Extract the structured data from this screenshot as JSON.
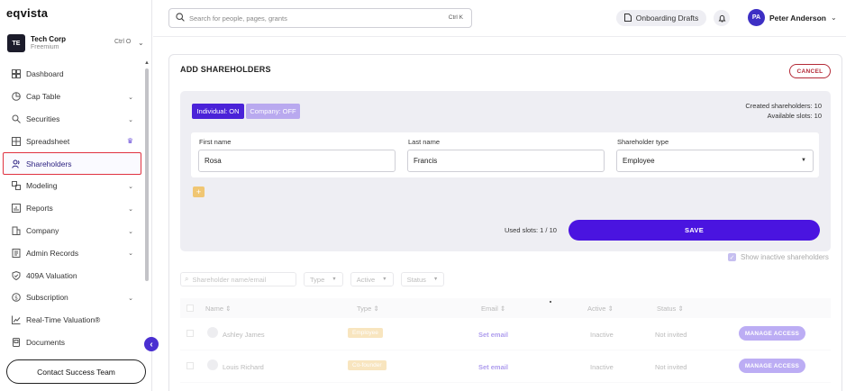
{
  "brand": {
    "logo": "eqvista"
  },
  "org": {
    "initials": "TE",
    "name": "Tech Corp",
    "plan": "Freemium",
    "shortcut": "Ctrl O"
  },
  "sidebar": {
    "items": [
      {
        "label": "Dashboard",
        "icon": "dashboard-icon",
        "chevron": false
      },
      {
        "label": "Cap Table",
        "icon": "pie-chart-icon",
        "chevron": true
      },
      {
        "label": "Securities",
        "icon": "securities-icon",
        "chevron": true
      },
      {
        "label": "Spreadsheet",
        "icon": "grid-icon",
        "chevron": false,
        "crown": true
      },
      {
        "label": "Shareholders",
        "icon": "users-icon",
        "chevron": false,
        "active": true
      },
      {
        "label": "Modeling",
        "icon": "modeling-icon",
        "chevron": true
      },
      {
        "label": "Reports",
        "icon": "reports-icon",
        "chevron": true
      },
      {
        "label": "Company",
        "icon": "company-icon",
        "chevron": true
      },
      {
        "label": "Admin Records",
        "icon": "records-icon",
        "chevron": true
      },
      {
        "label": "409A Valuation",
        "icon": "shield-icon",
        "chevron": false
      },
      {
        "label": "Subscription",
        "icon": "subscription-icon",
        "chevron": true
      },
      {
        "label": "Real-Time Valuation®",
        "icon": "trend-icon",
        "chevron": false
      },
      {
        "label": "Documents",
        "icon": "document-icon",
        "chevron": false
      }
    ],
    "contact_label": "Contact Success Team"
  },
  "topbar": {
    "search_placeholder": "Search for people, pages, grants",
    "search_shortcut": "Ctrl K",
    "drafts_label": "Onboarding Drafts",
    "user_initials": "PA",
    "user_name": "Peter Anderson"
  },
  "form": {
    "title": "ADD SHAREHOLDERS",
    "cancel_label": "CANCEL",
    "toggle_individual": "Individual: ON",
    "toggle_company": "Company: OFF",
    "created_text": "Created shareholders: 10",
    "available_text": "Available slots: 10",
    "first_name_label": "First name",
    "first_name_value": "Rosa",
    "last_name_label": "Last name",
    "last_name_value": "Francis",
    "type_label": "Shareholder type",
    "type_value": "Employee",
    "add_label": "+",
    "used_slots": "Used slots: 1 / 10",
    "save_label": "SAVE"
  },
  "list": {
    "show_inactive": "Show inactive shareholders",
    "search_placeholder": "Shareholder name/email",
    "filters": [
      "Type",
      "Active",
      "Status"
    ],
    "columns": [
      "Name",
      "Type",
      "Email",
      "Active",
      "Status"
    ],
    "rows": [
      {
        "name": "Ashley James",
        "type": "Employee",
        "email": "Set email",
        "active": "Inactive",
        "status": "Not invited",
        "action": "MANAGE ACCESS"
      },
      {
        "name": "Louis Richard",
        "type": "Co-founder",
        "email": "Set email",
        "active": "Inactive",
        "status": "Not invited",
        "action": "MANAGE ACCESS"
      }
    ]
  },
  "colors": {
    "accent": "#4a14e0",
    "danger": "#b42a37",
    "badge": "#f0c673"
  }
}
